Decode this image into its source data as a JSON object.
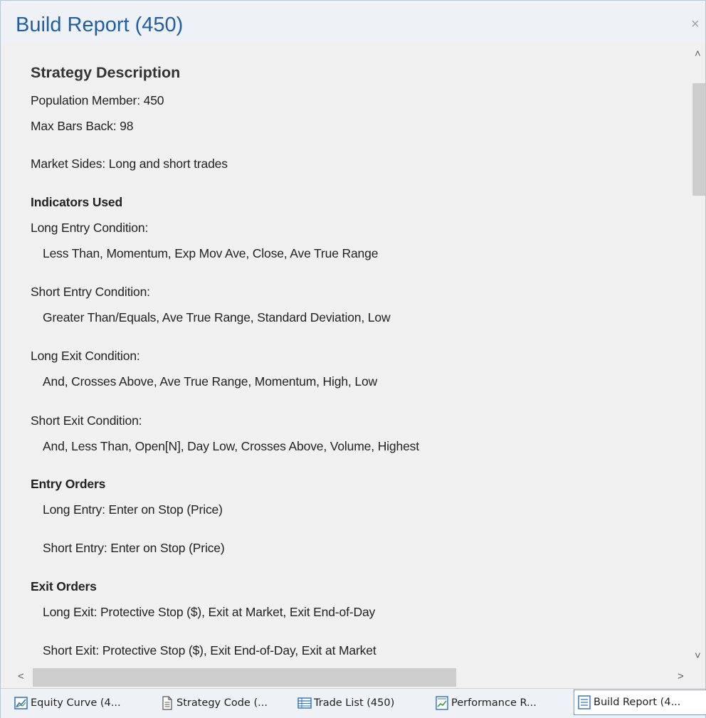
{
  "window": {
    "title": "Build Report (450)",
    "close_glyph": "×"
  },
  "report": {
    "heading": "Strategy Description",
    "population_member": "Population Member: 450",
    "max_bars_back": "Max Bars Back: 98",
    "market_sides": "Market Sides: Long and short trades",
    "indicators_heading": "Indicators Used",
    "conditions": [
      {
        "label": "Long Entry Condition:",
        "value": "Less Than, Momentum, Exp Mov Ave, Close, Ave True Range"
      },
      {
        "label": "Short Entry Condition:",
        "value": "Greater Than/Equals, Ave True Range, Standard Deviation, Low"
      },
      {
        "label": "Long Exit Condition:",
        "value": "And, Crosses Above, Ave True Range, Momentum, High, Low"
      },
      {
        "label": "Short Exit Condition:",
        "value": "And, Less Than, Open[N], Day Low, Crosses Above, Volume, Highest"
      }
    ],
    "entry_orders_heading": "Entry Orders",
    "entry_orders": [
      "Long Entry: Enter on Stop (Price)",
      "Short Entry: Enter on Stop (Price)"
    ],
    "exit_orders_heading": "Exit Orders",
    "exit_orders": [
      "Long Exit: Protective Stop ($), Exit at Market, Exit End-of-Day",
      "Short Exit: Protective Stop ($), Exit End-of-Day, Exit at Market"
    ]
  },
  "scrollbars": {
    "up": "˄",
    "down": "˅",
    "left": "<",
    "right": ">"
  },
  "tabs": [
    {
      "label": "Equity Curve (4...",
      "icon": "chart-icon",
      "active": false
    },
    {
      "label": "Strategy Code (...",
      "icon": "document-icon",
      "active": false
    },
    {
      "label": "Trade List (450)",
      "icon": "table-icon",
      "active": false
    },
    {
      "label": "Performance R...",
      "icon": "report-chart-icon",
      "active": false
    },
    {
      "label": "Build Report (4...",
      "icon": "list-document-icon",
      "active": true
    }
  ],
  "colors": {
    "title": "#1f5fa8",
    "background": "#f0f0f0",
    "tabbar": "#eef1f6",
    "icon_blue": "#2c6fbf",
    "icon_green": "#3a9a3a"
  }
}
